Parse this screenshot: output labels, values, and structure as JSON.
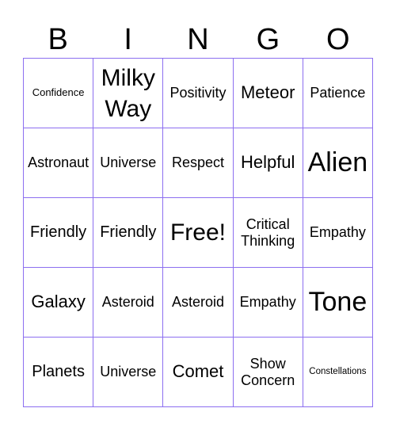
{
  "header": [
    "B",
    "I",
    "N",
    "G",
    "O"
  ],
  "grid_color": "#8c6ff0",
  "cells": [
    [
      "Confidence",
      "Milky Way",
      "Positivity",
      "Meteor",
      "Patience"
    ],
    [
      "Astronaut",
      "Universe",
      "Respect",
      "Helpful",
      "Alien"
    ],
    [
      "Friendly",
      "Friendly",
      "Free!",
      "Critical Thinking",
      "Empathy"
    ],
    [
      "Galaxy",
      "Asteroid",
      "Asteroid",
      "Empathy",
      "Tone"
    ],
    [
      "Planets",
      "Universe",
      "Comet",
      "Show Concern",
      "Constellations"
    ]
  ]
}
